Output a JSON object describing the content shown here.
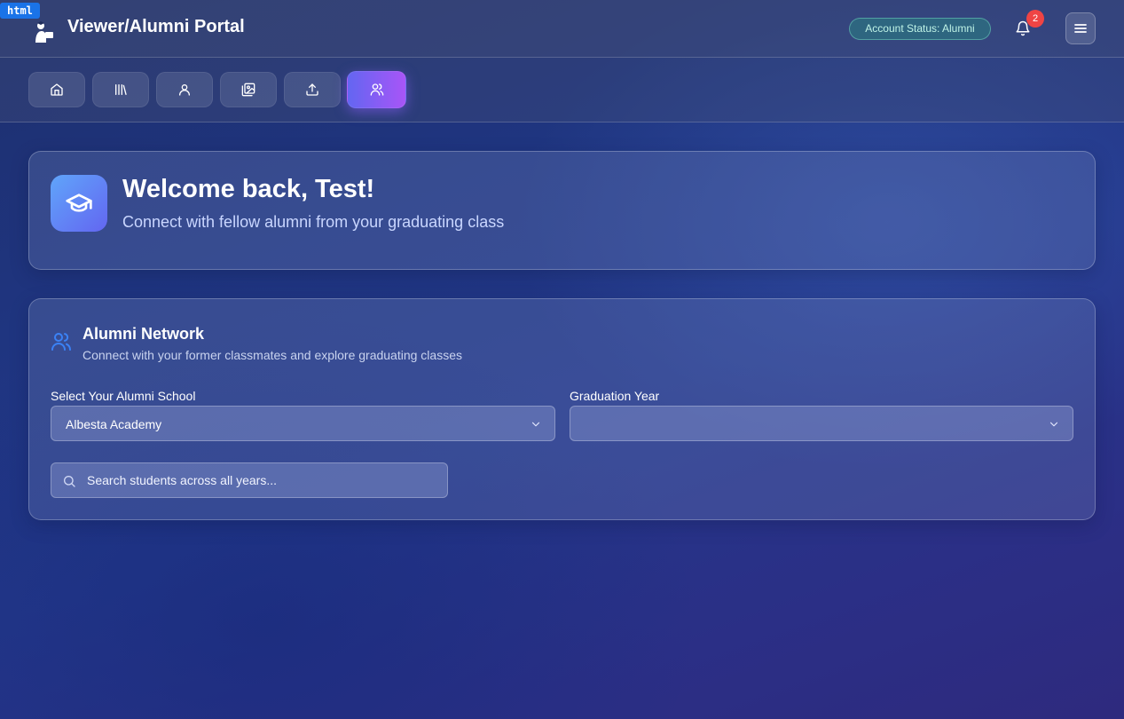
{
  "badge_label": "html",
  "header": {
    "title": "Viewer/Alumni Portal",
    "status": "Account Status: Alumni",
    "notification_count": "2"
  },
  "nav": {
    "items": [
      {
        "icon": "home-icon",
        "active": false
      },
      {
        "icon": "library-icon",
        "active": false
      },
      {
        "icon": "user-icon",
        "active": false
      },
      {
        "icon": "gallery-icon",
        "active": false
      },
      {
        "icon": "upload-icon",
        "active": false
      },
      {
        "icon": "users-icon",
        "active": true
      }
    ]
  },
  "welcome": {
    "title": "Welcome back, Test!",
    "subtitle": "Connect with fellow alumni from your graduating class"
  },
  "network": {
    "title": "Alumni Network",
    "subtitle": "Connect with your former classmates and explore graduating classes",
    "school_label": "Select Your Alumni School",
    "school_value": "Albesta Academy",
    "year_label": "Graduation Year",
    "year_value": "",
    "search_placeholder": "Search students across all years..."
  },
  "colors": {
    "accent_start": "#6366f1",
    "accent_end": "#a855f7",
    "badge": "#ef4444",
    "status_text": "#bff3e6"
  }
}
